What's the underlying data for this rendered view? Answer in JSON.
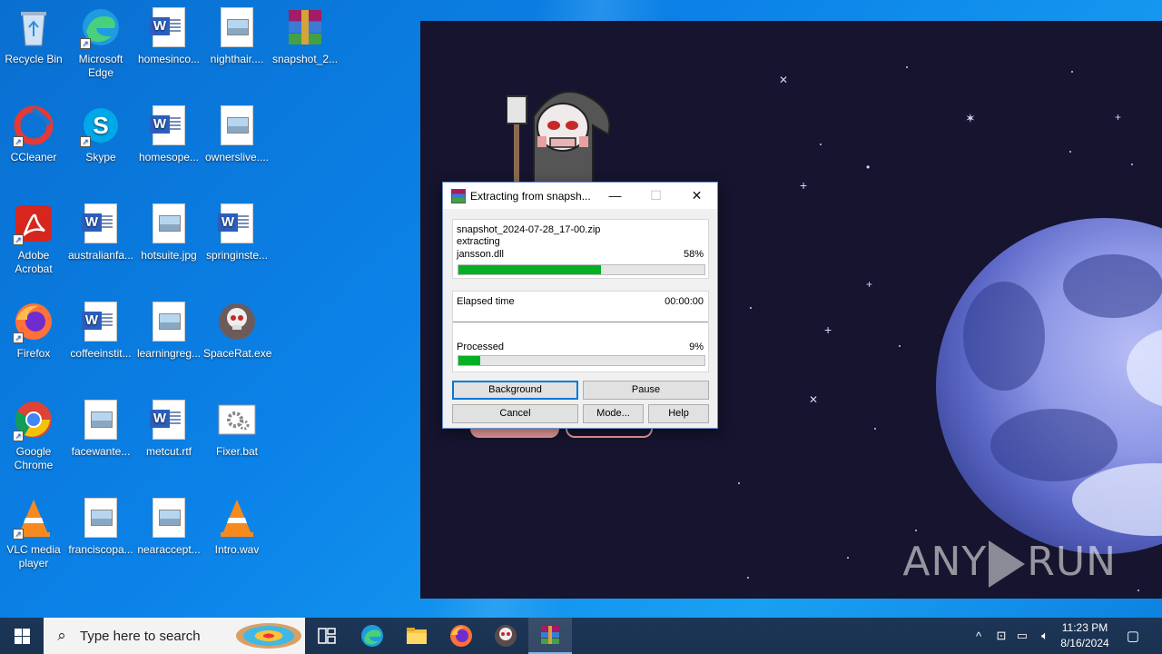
{
  "desktop": {
    "icons": [
      {
        "label": "Recycle Bin",
        "icon": "recycle-bin-icon"
      },
      {
        "label": "Microsoft Edge",
        "icon": "edge-icon"
      },
      {
        "label": "homesinco...",
        "icon": "word-document-icon"
      },
      {
        "label": "nighthair....",
        "icon": "image-file-icon"
      },
      {
        "label": "snapshot_2...",
        "icon": "winrar-archive-icon"
      },
      {
        "label": "CCleaner",
        "icon": "ccleaner-icon"
      },
      {
        "label": "Skype",
        "icon": "skype-icon"
      },
      {
        "label": "homesope...",
        "icon": "word-document-icon"
      },
      {
        "label": "ownerslive....",
        "icon": "image-file-icon"
      },
      {
        "label": "Adobe Acrobat",
        "icon": "adobe-acrobat-icon"
      },
      {
        "label": "australianfa...",
        "icon": "word-document-icon"
      },
      {
        "label": "hotsuite.jpg",
        "icon": "image-file-icon"
      },
      {
        "label": "springinste...",
        "icon": "word-document-icon"
      },
      {
        "label": "Firefox",
        "icon": "firefox-icon"
      },
      {
        "label": "coffeeinstit...",
        "icon": "word-document-icon"
      },
      {
        "label": "learningreg...",
        "icon": "image-file-icon"
      },
      {
        "label": "SpaceRat.exe",
        "icon": "spacerat-skull-icon"
      },
      {
        "label": "Google Chrome",
        "icon": "chrome-icon"
      },
      {
        "label": "facewante...",
        "icon": "image-file-icon"
      },
      {
        "label": "metcut.rtf",
        "icon": "word-document-icon"
      },
      {
        "label": "Fixer.bat",
        "icon": "batch-file-gear-icon"
      },
      {
        "label": "VLC media player",
        "icon": "vlc-icon"
      },
      {
        "label": "franciscopa...",
        "icon": "image-file-icon"
      },
      {
        "label": "nearaccept...",
        "icon": "image-file-icon"
      },
      {
        "label": "Intro.wav",
        "icon": "vlc-audio-icon"
      }
    ]
  },
  "dialog": {
    "title": "Extracting from snapsh...",
    "archive": "snapshot_2024-07-28_17-00.zip",
    "action": "extracting",
    "file": "jansson.dll",
    "file_percent_label": "58%",
    "file_progress": 0.58,
    "elapsed_label": "Elapsed time",
    "elapsed_value": "00:00:00",
    "processed_label": "Processed",
    "processed_percent_label": "9%",
    "processed_progress": 0.09,
    "buttons": {
      "background": "Background",
      "pause": "Pause",
      "cancel": "Cancel",
      "mode": "Mode...",
      "help": "Help"
    },
    "titlebar": {
      "minimize": "—",
      "maximize": "☐",
      "close": "✕"
    }
  },
  "watermark": {
    "left": "ANY",
    "right": "RUN"
  },
  "taskbar": {
    "search_placeholder": "Type here to search",
    "apps": [
      "task-view-icon",
      "edge-icon",
      "file-explorer-icon",
      "firefox-icon",
      "spacerat-skull-icon",
      "winrar-icon"
    ],
    "time": "11:23 PM",
    "date": "8/16/2024"
  },
  "colors": {
    "progress_fill": "#06b025",
    "desktop_blue": "#0b82e8",
    "scene_bg": "#16142e"
  }
}
